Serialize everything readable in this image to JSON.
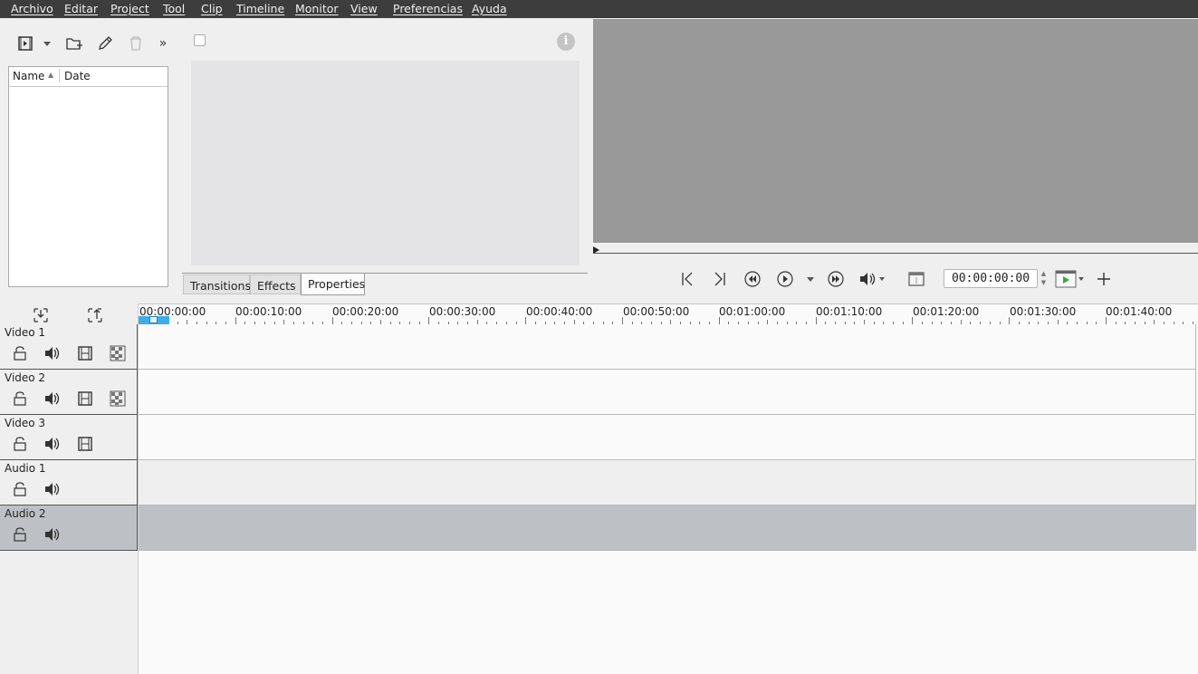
{
  "menubar": {
    "items": [
      "Archivo",
      "Editar",
      "Project",
      "Tool",
      "Clip",
      "Timeline",
      "Monitor",
      "View",
      "Preferencias",
      "Ayuda"
    ]
  },
  "project_bin": {
    "toolbar_icons": [
      "add-clip-icon",
      "dropdown-arrow-icon",
      "new-folder-icon",
      "edit-pencil-icon",
      "delete-trash-icon",
      "more-chevrons-icon"
    ],
    "more_label": "»",
    "columns": [
      "Name",
      "Date"
    ],
    "sort_indicator": "▲"
  },
  "properties": {
    "info_label": "i",
    "tabs": [
      "Transitions",
      "Effects",
      "Properties"
    ],
    "active_tab": "Properties"
  },
  "monitor": {
    "timecode": "00:00:00:00",
    "spin_up": "▲",
    "spin_down": "▼"
  },
  "timeline": {
    "ruler_labels": [
      "00:00:00:00",
      "00:00:10:00",
      "00:00:20:00",
      "00:00:30:00",
      "00:00:40:00",
      "00:00:50:00",
      "00:01:00:00",
      "00:01:10:00",
      "00:01:20:00",
      "00:01:30:00",
      "00:01:40:00"
    ],
    "tracks": [
      {
        "name": "Video 1",
        "type": "video",
        "compositing": true
      },
      {
        "name": "Video 2",
        "type": "video",
        "compositing": true
      },
      {
        "name": "Video 3",
        "type": "video",
        "compositing": false
      },
      {
        "name": "Audio 1",
        "type": "audio"
      },
      {
        "name": "Audio 2",
        "type": "audio",
        "selected": true
      }
    ]
  },
  "colors": {
    "menubar_bg": "#3d3d3d",
    "monitor_bg": "#999999",
    "playhead": "#3daee9",
    "selected_track": "#bdc1c5",
    "audio_track": "#efeff0"
  }
}
